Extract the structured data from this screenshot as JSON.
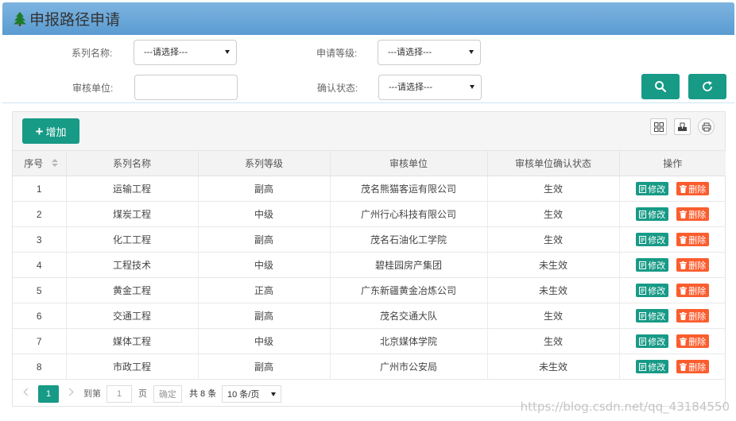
{
  "header": {
    "title": "申报路径申请",
    "icon": "tree-icon"
  },
  "filters": {
    "series_name_label": "系列名称:",
    "series_name_value": "---请选择---",
    "apply_level_label": "申请等级:",
    "apply_level_value": "---请选择---",
    "review_unit_label": "审核单位:",
    "review_unit_value": "",
    "confirm_status_label": "确认状态:",
    "confirm_status_value": "---请选择---",
    "search_icon": "search-icon",
    "refresh_icon": "refresh-icon",
    "accent": "#179a86"
  },
  "toolbar": {
    "add_label": "增加"
  },
  "table": {
    "columns": [
      "序号",
      "系列名称",
      "系列等级",
      "审核单位",
      "审核单位确认状态",
      "操作"
    ],
    "edit_label": "修改",
    "delete_label": "删除",
    "delete_color": "#fb5d2e",
    "rows": [
      {
        "no": "1",
        "name": "运输工程",
        "level": "副高",
        "unit": "茂名熊猫客运有限公司",
        "status": "生效"
      },
      {
        "no": "2",
        "name": "煤炭工程",
        "level": "中级",
        "unit": "广州行心科技有限公司",
        "status": "生效"
      },
      {
        "no": "3",
        "name": "化工工程",
        "level": "副高",
        "unit": "茂名石油化工学院",
        "status": "生效"
      },
      {
        "no": "4",
        "name": "工程技术",
        "level": "中级",
        "unit": "碧桂园房产集团",
        "status": "未生效"
      },
      {
        "no": "5",
        "name": "黄金工程",
        "level": "正高",
        "unit": "广东新疆黄金冶炼公司",
        "status": "未生效"
      },
      {
        "no": "6",
        "name": "交通工程",
        "level": "副高",
        "unit": "茂名交通大队",
        "status": "生效"
      },
      {
        "no": "7",
        "name": "媒体工程",
        "level": "中级",
        "unit": "北京媒体学院",
        "status": "生效"
      },
      {
        "no": "8",
        "name": "市政工程",
        "level": "副高",
        "unit": "广州市公安局",
        "status": "未生效"
      }
    ]
  },
  "pager": {
    "current": "1",
    "goto_label": "到第",
    "goto_value": "1",
    "page_label": "页",
    "confirm_label": "确定",
    "total_label": "共 8 条",
    "page_size": "10 条/页"
  },
  "watermark": "https://blog.csdn.net/qq_43184550"
}
